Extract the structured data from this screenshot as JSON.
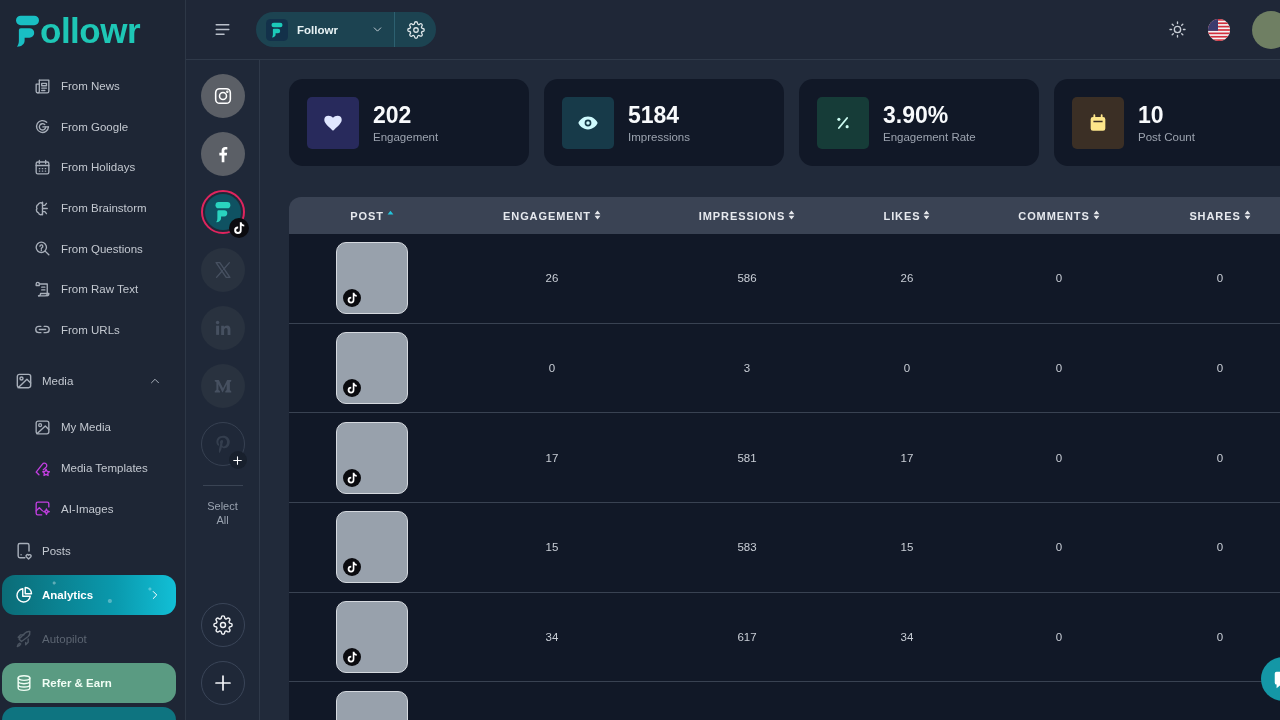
{
  "sidebar": {
    "logo": "ollowr",
    "nav": [
      {
        "kind": "group",
        "children": [
          {
            "label": "From News",
            "selected": false
          },
          {
            "label": "From Google",
            "selected": false
          },
          {
            "label": "From Holidays",
            "selected": false
          },
          {
            "label": "From Brainstorm",
            "selected": false
          },
          {
            "label": "From Questions",
            "selected": false
          },
          {
            "label": "From Raw Text",
            "selected": false
          },
          {
            "label": "From URLs",
            "selected": false
          }
        ]
      },
      {
        "kind": "section",
        "label": "Media",
        "expanded": true,
        "selected": false,
        "disabled": false,
        "children": [
          {
            "label": "My Media",
            "selected": false
          },
          {
            "label": "Media Templates",
            "selected": false
          },
          {
            "label": "AI-Images",
            "selected": false
          }
        ]
      },
      {
        "kind": "link",
        "label": "Posts",
        "selected": false,
        "disabled": false
      },
      {
        "kind": "link",
        "label": "Analytics",
        "selected": true,
        "disabled": false
      },
      {
        "kind": "link",
        "label": "Autopilot",
        "selected": false,
        "disabled": true
      },
      {
        "kind": "promo",
        "label": "Refer & Earn",
        "selected": false,
        "disabled": false
      }
    ]
  },
  "topbar": {
    "workspace": "Followr"
  },
  "accounts": [
    {
      "kind": "instagram",
      "connected": true,
      "disabled": false,
      "selected": false
    },
    {
      "kind": "facebook",
      "connected": true,
      "disabled": false,
      "selected": false
    },
    {
      "kind": "followr",
      "connected": true,
      "disabled": false,
      "selected": true,
      "badge": {
        "kind": "tiktok"
      }
    },
    {
      "kind": "x",
      "connected": true,
      "disabled": true,
      "selected": false
    },
    {
      "kind": "linkedin",
      "connected": true,
      "disabled": true,
      "selected": false
    },
    {
      "kind": "medium",
      "connected": true,
      "disabled": true,
      "selected": false
    },
    {
      "kind": "pinterest",
      "connected": false,
      "disabled": false,
      "selected": false
    }
  ],
  "select_all": "Select All",
  "stats": [
    {
      "value": "202",
      "label": "Engagement",
      "color": "#282a5c"
    },
    {
      "value": "5184",
      "label": "Impressions",
      "color": "#173a49"
    },
    {
      "value": "3.90%",
      "label": "Engagement Rate",
      "color": "#163c38"
    },
    {
      "value": "10",
      "label": "Post Count",
      "color": "#3b2f25"
    }
  ],
  "table": {
    "columns": [
      {
        "label": "POST",
        "sorted": true
      },
      {
        "label": "ENGAGEMENT",
        "sorted": false
      },
      {
        "label": "IMPRESSIONS",
        "sorted": false
      },
      {
        "label": "LIKES",
        "sorted": false
      },
      {
        "label": "COMMENTS",
        "sorted": false
      },
      {
        "label": "SHARES",
        "sorted": false
      }
    ],
    "rows": [
      {
        "kind": "tiktok",
        "cells": [
          "26",
          "586",
          "26",
          "0",
          "0"
        ]
      },
      {
        "kind": "tiktok",
        "cells": [
          "0",
          "3",
          "0",
          "0",
          "0"
        ]
      },
      {
        "kind": "tiktok",
        "cells": [
          "17",
          "581",
          "17",
          "0",
          "0"
        ]
      },
      {
        "kind": "tiktok",
        "cells": [
          "15",
          "583",
          "15",
          "0",
          "0"
        ]
      },
      {
        "kind": "tiktok",
        "cells": [
          "34",
          "617",
          "34",
          "0",
          "0"
        ]
      },
      {
        "kind": "partial"
      }
    ]
  }
}
